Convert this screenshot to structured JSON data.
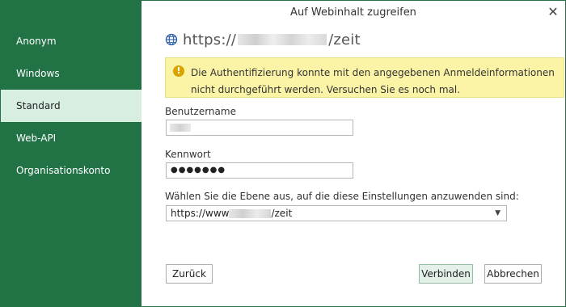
{
  "dialog": {
    "title": "Auf Webinhalt zugreifen",
    "close_glyph": "✕"
  },
  "sidebar": {
    "items": [
      {
        "label": "Anonym",
        "active": false
      },
      {
        "label": "Windows",
        "active": false
      },
      {
        "label": "Standard",
        "active": true
      },
      {
        "label": "Web-API",
        "active": false
      },
      {
        "label": "Organisationskonto",
        "active": false
      }
    ]
  },
  "url": {
    "prefix": "https://",
    "suffix": "/zeit",
    "icon": "globe-icon"
  },
  "warning": {
    "icon": "warning-icon",
    "glyph": "!",
    "text": "Die Authentifizierung konnte mit den angegebenen Anmeldeinformationen nicht durchgeführt werden. Versuchen Sie es noch mal."
  },
  "form": {
    "username_label": "Benutzername",
    "password_label": "Kennwort",
    "password_value": "●●●●●●●",
    "level_label": "Wählen Sie die Ebene aus, auf die diese Einstellungen anzuwenden sind:",
    "level_prefix": "https://www",
    "level_suffix": "/zeit",
    "level_caret": "▼"
  },
  "buttons": {
    "back": "Zurück",
    "connect": "Verbinden",
    "cancel": "Abbrechen"
  },
  "colors": {
    "accent": "#217346",
    "active_nav": "#d8eee1",
    "warning_bg": "#fbf4a7"
  }
}
